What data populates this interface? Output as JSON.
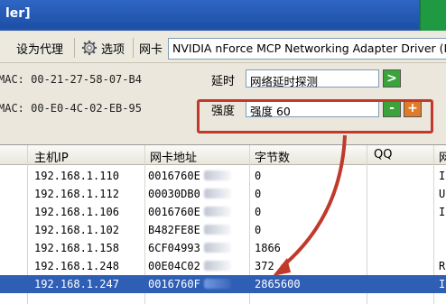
{
  "window": {
    "title": "ler]"
  },
  "toolbar": {
    "set_proxy_label": "设为代理",
    "options_label": "选项",
    "adapter_label": "网卡",
    "adapter_value": "NVIDIA nForce MCP Networking Adapter Driver (Mi"
  },
  "info": {
    "mac1": "MAC: 00-21-27-58-07-B4",
    "mac2": "MAC: 00-E0-4C-02-EB-95",
    "latency_label": "延时",
    "latency_value": "网络延时探测",
    "latency_go": ">",
    "strength_label": "强度",
    "strength_value": "强度 60",
    "strength_minus": "-",
    "strength_plus": "+"
  },
  "table": {
    "columns": [
      "主机IP",
      "网卡地址",
      "字节数",
      "QQ",
      "网"
    ],
    "rows": [
      {
        "ip": "192.168.1.110",
        "mac": "0016760E",
        "bytes": "0",
        "qq": "",
        "extra": "I:",
        "selected": false
      },
      {
        "ip": "192.168.1.112",
        "mac": "00030DB0",
        "bytes": "0",
        "qq": "",
        "extra": "U:",
        "selected": false
      },
      {
        "ip": "192.168.1.106",
        "mac": "0016760E",
        "bytes": "0",
        "qq": "",
        "extra": "I:",
        "selected": false
      },
      {
        "ip": "192.168.1.102",
        "mac": "B482FE8E",
        "bytes": "0",
        "qq": "",
        "extra": "",
        "selected": false
      },
      {
        "ip": "192.168.1.158",
        "mac": "6CF04993",
        "bytes": "1866",
        "qq": "",
        "extra": "",
        "selected": false
      },
      {
        "ip": "192.168.1.248",
        "mac": "00E04C02",
        "bytes": "372",
        "qq": "",
        "extra": "R:",
        "selected": false
      },
      {
        "ip": "192.168.1.247",
        "mac": "0016760F",
        "bytes": "2865600",
        "qq": "",
        "extra": "I:",
        "selected": true
      }
    ]
  },
  "colors": {
    "title_bar": "#1c4fa6",
    "selected_row": "#2f5fb4",
    "annotation": "#c0392b",
    "go_button": "#3aa33a",
    "minus_button": "#3aa33a",
    "plus_button": "#e07b2a"
  }
}
